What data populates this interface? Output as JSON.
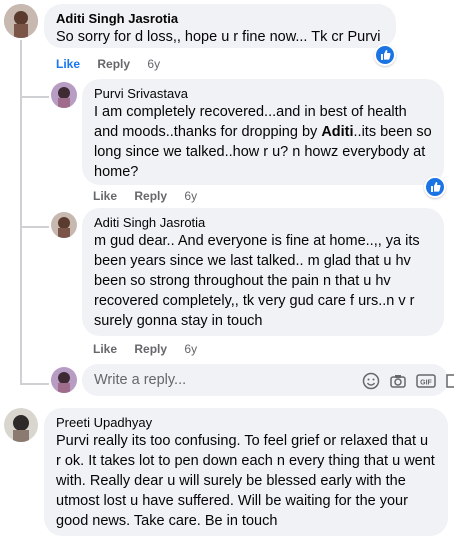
{
  "comments": [
    {
      "author": "Aditi Singh Jasrotia",
      "text": "So sorry for d loss,, hope u r fine now... Tk cr Purvi",
      "actions": {
        "like": "Like",
        "reply": "Reply",
        "time": "6y"
      }
    },
    {
      "author": "Purvi Srivastava",
      "text_before_bold": "I am completely recovered...and in best of health and moods..thanks for dropping by ",
      "text_bold": "Aditi",
      "text_after_bold": "..its been so long since we talked..how r u? n howz everybody at home?",
      "actions": {
        "like": "Like",
        "reply": "Reply",
        "time": "6y"
      }
    },
    {
      "author": "Aditi Singh Jasrotia",
      "text": "m gud dear.. And everyone is fine at home..,, ya its been years since we last talked.. m glad that u hv been so strong throughout the pain n that u hv recovered completely,, tk very gud care f urs..n v r surely gonna stay in touch",
      "actions": {
        "like": "Like",
        "reply": "Reply",
        "time": "6y"
      }
    },
    {
      "author": "Preeti Upadhyay",
      "text": "Purvi really its too confusing. To feel grief or relaxed that u r ok. It takes lot to pen down each n every thing that u went with. Really dear u will surely be blessed early with the utmost lost u have suffered. Will be waiting for the your good news. Take care. Be in touch"
    }
  ],
  "reply_input": {
    "placeholder": "Write a reply...",
    "tools": [
      "emoji-icon",
      "camera-icon",
      "gif-icon",
      "sticker-icon"
    ],
    "gif_label": "GIF"
  },
  "colors": {
    "like_active": "#1877f2",
    "bubble": "#f0f2f5",
    "meta": "#65676b"
  }
}
